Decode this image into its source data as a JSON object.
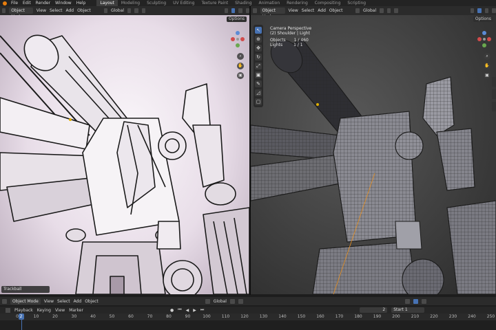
{
  "topmenu": {
    "items": [
      "File",
      "Edit",
      "Render",
      "Window",
      "Help"
    ],
    "workspaces": [
      "Layout",
      "Modeling",
      "Sculpting",
      "UV Editing",
      "Texture Paint",
      "Shading",
      "Animation",
      "Rendering",
      "Compositing",
      "Scripting"
    ],
    "active_workspace": "Layout"
  },
  "left_view": {
    "header": {
      "mode": "Object Mode",
      "view": "View",
      "select": "Select",
      "add": "Add",
      "object": "Object",
      "orientation": "Global"
    },
    "options": "Options",
    "trackball": "Trackball"
  },
  "right_view": {
    "header": {
      "mode": "Object Mode",
      "view": "View",
      "select": "Select",
      "add": "Add",
      "object": "Object",
      "orientation": "Global"
    },
    "options": "Options",
    "overlay": {
      "camera": "Camera Perspective",
      "collection": "(2) Shoulder | Light",
      "objects_label": "Objects",
      "objects_value": "1 / 460",
      "lights_label": "Lights",
      "lights_value": "1 / 1"
    }
  },
  "bottom_header": {
    "mode": "Object Mode",
    "view": "View",
    "select": "Select",
    "add": "Add",
    "object": "Object",
    "orientation": "Global"
  },
  "timeline": {
    "playback": "Playback",
    "keying": "Keying",
    "view": "View",
    "marker": "Marker",
    "current_frame": "2",
    "start_label": "Start",
    "start_value": "1",
    "ticks": [
      "0",
      "10",
      "20",
      "30",
      "40",
      "50",
      "60",
      "70",
      "80",
      "90",
      "100",
      "110",
      "120",
      "130",
      "140",
      "150",
      "160",
      "170",
      "180",
      "190",
      "200",
      "210",
      "220",
      "230",
      "240",
      "250"
    ],
    "playhead": 2
  },
  "colors": {
    "accent": "#4772b3",
    "logo": "#e87d0d"
  }
}
